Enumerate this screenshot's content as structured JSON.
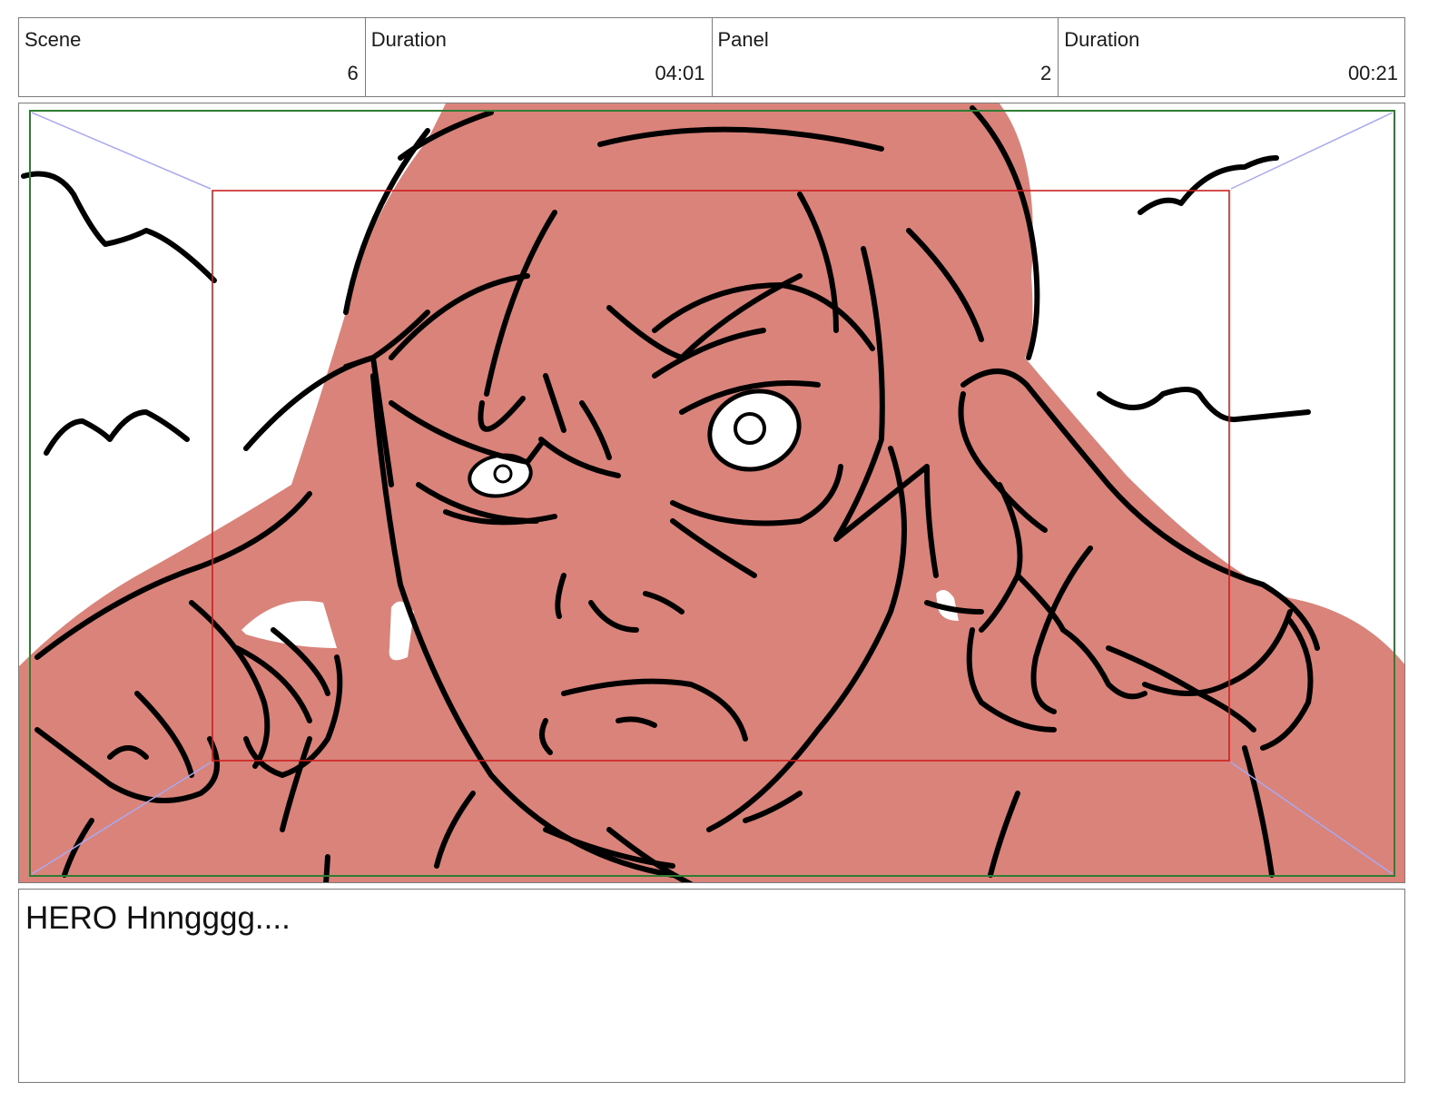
{
  "header": {
    "scene_label": "Scene",
    "scene_value": "6",
    "scene_duration_label": "Duration",
    "scene_duration_value": "04:01",
    "panel_label": "Panel",
    "panel_value": "2",
    "panel_duration_label": "Duration",
    "panel_duration_value": "00:21"
  },
  "panel": {
    "skin_color": "#d9837a",
    "line_color": "#000000",
    "safe_frame_color": "#2e7d32",
    "camera_frame_color": "#cc1f1f",
    "camera_move_color": "#a9a9f0"
  },
  "notes": {
    "dialogue": "HERO Hnngggg...."
  }
}
